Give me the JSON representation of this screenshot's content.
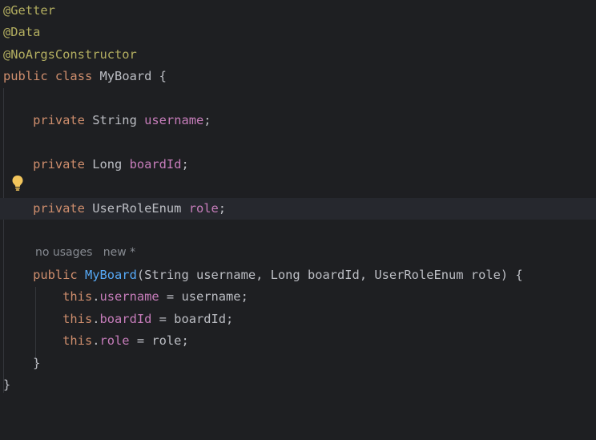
{
  "editor": {
    "lines": [
      {
        "annotation": "@Getter"
      },
      {
        "annotation": "@Data"
      },
      {
        "annotation": "@NoArgsConstructor"
      },
      {
        "kw1": "public",
        "kw2": "class",
        "name": "MyBoard",
        "brace": "{"
      },
      {},
      {
        "kw": "private",
        "type": "String",
        "field": "username",
        "semi": ";"
      },
      {},
      {
        "kw": "private",
        "type": "Long",
        "field": "boardId",
        "semi": ";"
      },
      {},
      {
        "kw": "private",
        "type": "UserRoleEnum",
        "field": "role",
        "semi": ";"
      },
      {},
      {
        "usages": "no usages",
        "author": "new *"
      },
      {
        "kw": "public",
        "name": "MyBoard",
        "params": "(String username, Long boardId, UserRoleEnum role) {"
      },
      {
        "this": "this",
        "field": "username",
        "rest": " = username;"
      },
      {
        "this": "this",
        "field": "boardId",
        "rest": " = boardId;"
      },
      {
        "this": "this",
        "field": "role",
        "rest": " = role;"
      },
      {
        "brace": "}"
      },
      {
        "brace": "}"
      }
    ],
    "colors": {
      "background": "#1e1f22",
      "current_line": "#26282e",
      "keyword": "#cf8e6d",
      "annotation": "#b3ae60",
      "field": "#c77dbb",
      "method": "#56a8f5",
      "text": "#bcbec4",
      "hint": "#868a91"
    },
    "gutter_icon": "lightbulb-icon"
  }
}
